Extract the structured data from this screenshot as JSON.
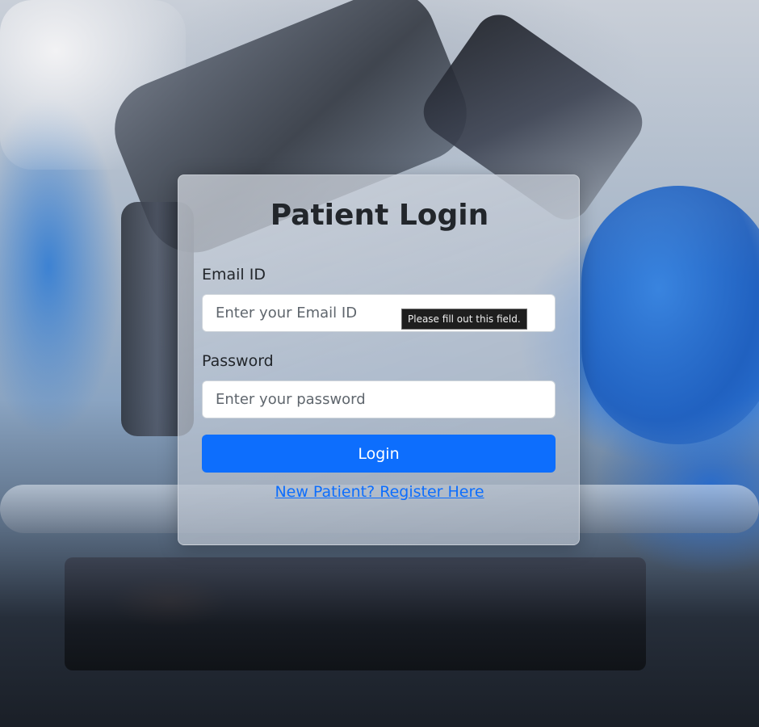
{
  "login": {
    "title": "Patient Login",
    "email_label": "Email ID",
    "email_placeholder": "Enter your Email ID",
    "email_value": "",
    "validation_tooltip": "Please fill out this field.",
    "password_label": "Password",
    "password_placeholder": "Enter your password",
    "password_value": "",
    "submit_label": "Login",
    "register_link": "New Patient? Register Here"
  },
  "colors": {
    "primary": "#0d6efd",
    "text": "#22262b",
    "tooltip_bg": "#1e1e1e"
  },
  "background": {
    "description_icon": "laboratory-microscope-photo"
  }
}
